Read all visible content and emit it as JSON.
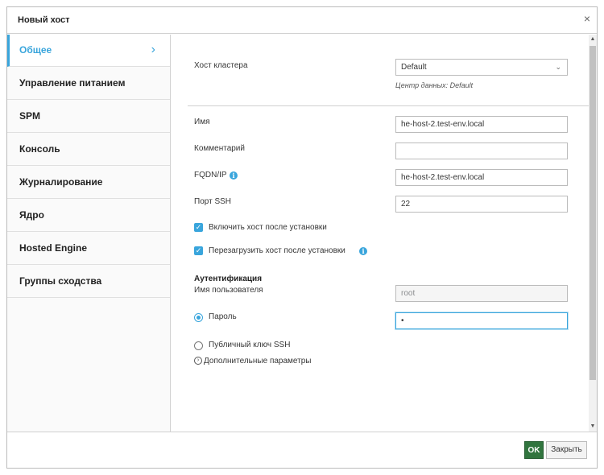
{
  "dialog": {
    "title": "Новый хост",
    "close_symbol": "×"
  },
  "sidebar": {
    "items": [
      {
        "label": "Общее",
        "active": true
      },
      {
        "label": "Управление питанием"
      },
      {
        "label": "SPM"
      },
      {
        "label": "Консоль"
      },
      {
        "label": "Журналирование"
      },
      {
        "label": "Ядро"
      },
      {
        "label": "Hosted Engine"
      },
      {
        "label": "Группы сходства"
      }
    ],
    "chevron": "›"
  },
  "form": {
    "cluster": {
      "label": "Хост кластера",
      "value": "Default",
      "hint": "Центр данных: Default"
    },
    "name": {
      "label": "Имя",
      "value": "he-host-2.test-env.local"
    },
    "comment": {
      "label": "Комментарий",
      "value": ""
    },
    "fqdn": {
      "label": "FQDN/IP",
      "value": "he-host-2.test-env.local"
    },
    "ssh_port": {
      "label": "Порт SSH",
      "value": "22"
    },
    "activate_after_install": {
      "label": "Включить хост после установки",
      "checked": true
    },
    "reboot_after_install": {
      "label": "Перезагрузить хост после установки",
      "checked": true
    },
    "auth": {
      "title": "Аутентификация",
      "username_label": "Имя пользователя",
      "username_value": "root",
      "password_label": "Пароль",
      "password_value": "•",
      "ssh_key_label": "Публичный ключ SSH"
    },
    "advanced_label": "Дополнительные параметры"
  },
  "footer": {
    "ok_label": "OK",
    "close_label": "Закрыть"
  },
  "colors": {
    "accent": "#39a5dc",
    "ok_button": "#31753e"
  }
}
